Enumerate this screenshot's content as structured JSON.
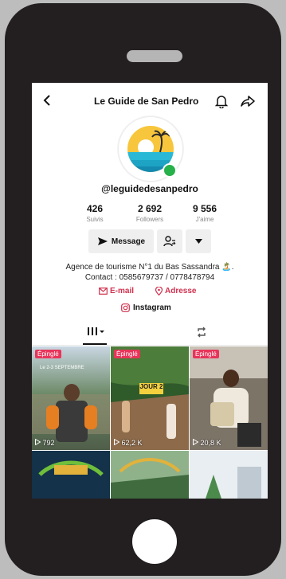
{
  "header": {
    "title": "Le Guide de San Pedro"
  },
  "icons": {
    "back": "chevron-left-icon",
    "bell": "bell-icon",
    "share": "share-icon",
    "verified_dot": "status-dot-icon"
  },
  "profile": {
    "username": "@leguidedesanpedro",
    "stats": [
      {
        "number": "426",
        "label": "Suivis"
      },
      {
        "number": "2 692",
        "label": "Followers"
      },
      {
        "number": "9 556",
        "label": "J'aime"
      }
    ],
    "bio_line1": "Agence de tourisme N°1 du Bas Sassandra 🏝️.",
    "bio_line2": "Contact : 0585679737 / 0778478794",
    "email_label": "E-mail",
    "address_label": "Adresse",
    "instagram_label": "Instagram"
  },
  "actions": {
    "message_label": "Message"
  },
  "grid": {
    "badge_label": "Épinglé",
    "videos": [
      {
        "views": "792",
        "pinned": true
      },
      {
        "views": "62,2 K",
        "pinned": true,
        "overlay": "JOUR 2"
      },
      {
        "views": "20,8 K",
        "pinned": true
      },
      {
        "views": ""
      },
      {
        "views": ""
      },
      {
        "views": ""
      }
    ]
  },
  "colors": {
    "accent": "#e8345a",
    "link": "#d0304e",
    "online": "#27b14a"
  }
}
